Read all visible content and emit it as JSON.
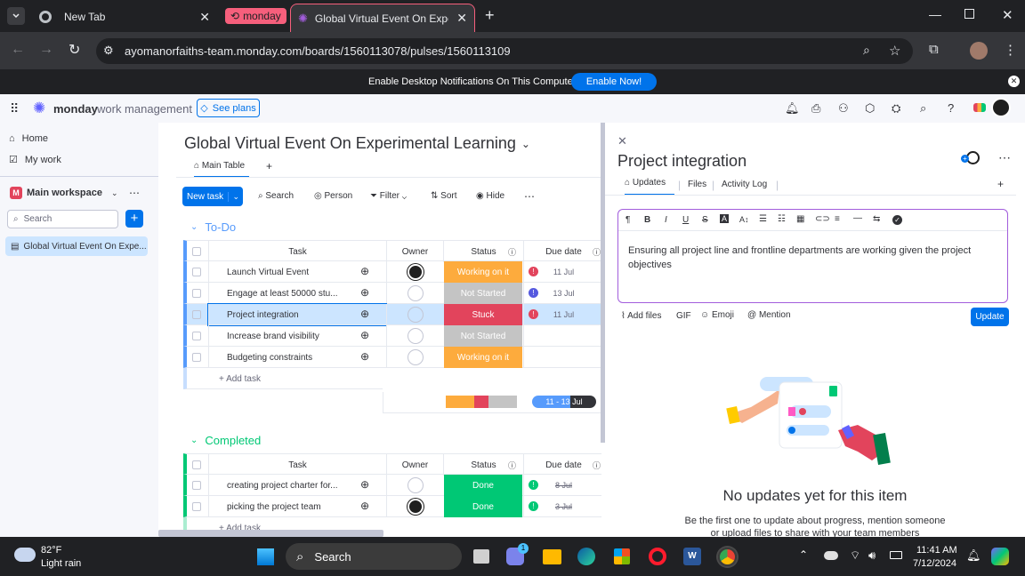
{
  "browser": {
    "tabs": [
      {
        "label": "New Tab"
      },
      {
        "label": "monday"
      },
      {
        "label": "Global Virtual Event On Experim"
      }
    ],
    "url": "ayomanorfaiths-team.monday.com/boards/1560113078/pulses/1560113109"
  },
  "notification": {
    "text": "Enable Desktop Notifications On This Computer",
    "button": "Enable Now!"
  },
  "app": {
    "brand": "monday",
    "brand_suffix": "work management",
    "see_plans": "See plans"
  },
  "sidebar": {
    "home": "Home",
    "mywork": "My work",
    "workspace": "Main workspace",
    "workspace_initial": "M",
    "search_placeholder": "Search",
    "board_item": "Global Virtual Event On Expe..."
  },
  "board": {
    "title": "Global Virtual Event On Experimental Learning",
    "view_tab": "Main Table",
    "toolbar": {
      "new_task": "New task",
      "search": "Search",
      "person": "Person",
      "filter": "Filter",
      "sort": "Sort",
      "hide": "Hide"
    },
    "columns": {
      "task": "Task",
      "owner": "Owner",
      "status": "Status",
      "due": "Due date"
    },
    "groups": [
      {
        "name": "To-Do",
        "color": "#579bfc",
        "rows": [
          {
            "task": "Launch Virtual Event",
            "owner": "filled",
            "status": "Working on it",
            "status_color": "#fdab3d",
            "alert": "red",
            "due": "11 Jul"
          },
          {
            "task": "Engage at least 50000 stu...",
            "owner": "empty",
            "status": "Not Started",
            "status_color": "#c4c4c4",
            "alert": "gray",
            "due": "13 Jul"
          },
          {
            "task": "Project integration",
            "owner": "empty",
            "status": "Stuck",
            "status_color": "#e2445c",
            "alert": "red",
            "due": "11 Jul"
          },
          {
            "task": "Increase brand visibility",
            "owner": "empty",
            "status": "Not Started",
            "status_color": "#c4c4c4",
            "alert": "",
            "due": ""
          },
          {
            "task": "Budgeting constraints",
            "owner": "empty",
            "status": "Working on it",
            "status_color": "#fdab3d",
            "alert": "",
            "due": ""
          }
        ],
        "add_label": "+ Add task",
        "date_summary": "11 - 13 Jul"
      },
      {
        "name": "Completed",
        "color": "#00c875",
        "rows": [
          {
            "task": "creating project charter for...",
            "owner": "empty",
            "status": "Done",
            "status_color": "#00c875",
            "alert": "green",
            "due": "8 Jul"
          },
          {
            "task": "picking the project team",
            "owner": "filled",
            "status": "Done",
            "status_color": "#00c875",
            "alert": "green",
            "due": "3 Jul"
          }
        ],
        "add_label": "+ Add task"
      }
    ]
  },
  "panel": {
    "title": "Project integration",
    "tabs": {
      "updates": "Updates",
      "files": "Files",
      "activity": "Activity Log"
    },
    "editor_text": "Ensuring all project line and frontline departments are working given the project objectives",
    "actions": {
      "add_files": "Add files",
      "gif": "GIF",
      "emoji": "Emoji",
      "mention": "Mention",
      "update": "Update"
    },
    "empty_title": "No updates yet for this item",
    "empty_desc_1": "Be the first one to update about progress, mention someone",
    "empty_desc_2": "or upload files to share with your team members"
  },
  "taskbar": {
    "temp": "82°F",
    "weather": "Light rain",
    "search": "Search",
    "time": "11:41 AM",
    "date": "7/12/2024",
    "badge": "1"
  },
  "colors": {
    "primary": "#0073ea",
    "working": "#fdab3d",
    "stuck": "#e2445c",
    "done": "#00c875",
    "notstarted": "#c4c4c4"
  }
}
